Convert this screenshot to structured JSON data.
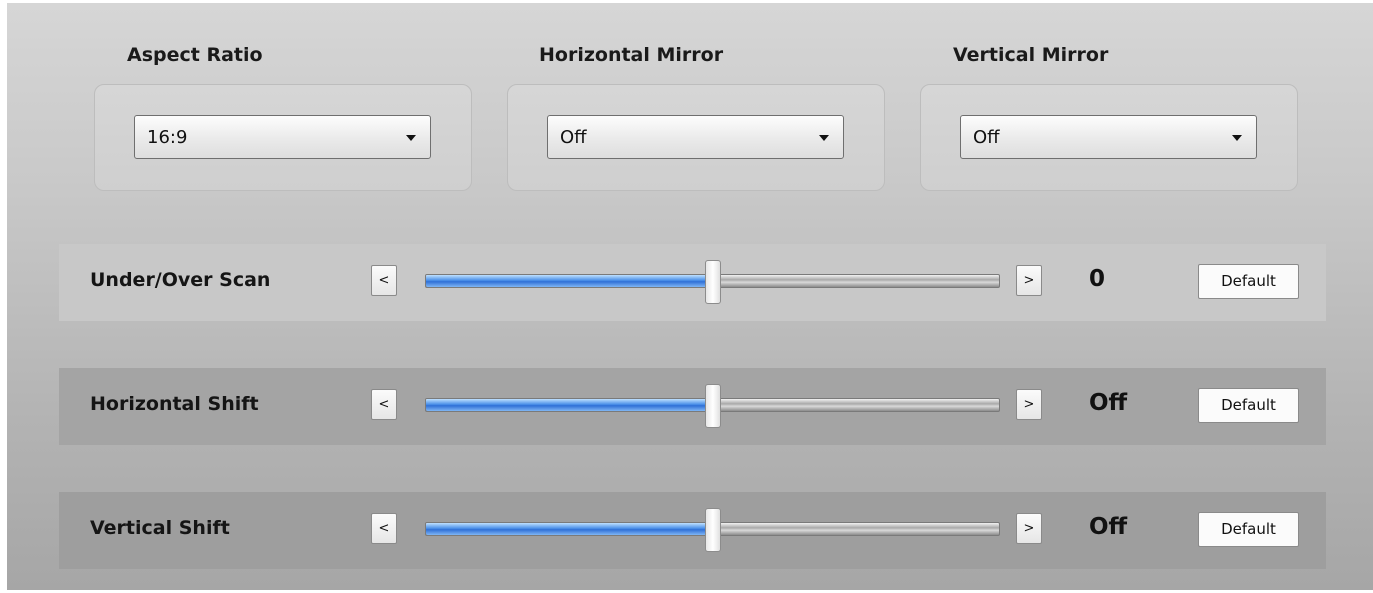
{
  "dropdowns": [
    {
      "label": "Aspect Ratio",
      "value": "16:9"
    },
    {
      "label": "Horizontal Mirror",
      "value": "Off"
    },
    {
      "label": "Vertical Mirror",
      "value": "Off"
    }
  ],
  "sliders": [
    {
      "label": "Under/Over Scan",
      "value_text": "0",
      "position": 0.5,
      "decrement": "<",
      "increment": ">",
      "default_label": "Default"
    },
    {
      "label": "Horizontal Shift",
      "value_text": "Off",
      "position": 0.5,
      "decrement": "<",
      "increment": ">",
      "default_label": "Default"
    },
    {
      "label": "Vertical Shift",
      "value_text": "Off",
      "position": 0.5,
      "decrement": "<",
      "increment": ">",
      "default_label": "Default"
    }
  ],
  "colors": {
    "slider_fill": "#3f84e5",
    "row_light": "#c8c8c8",
    "row_dark": "#a2a2a2"
  },
  "icons": {
    "dropdown_arrow": "triangle-down-icon"
  }
}
